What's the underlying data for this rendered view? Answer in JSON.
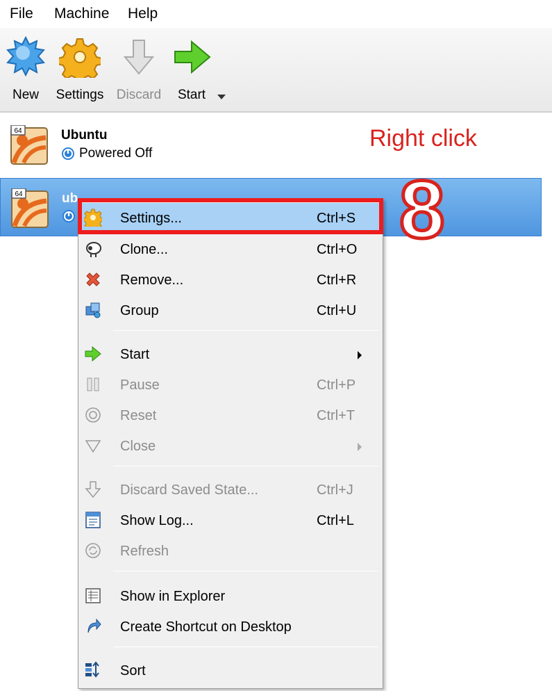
{
  "menubar": {
    "file": "File",
    "machine": "Machine",
    "help": "Help"
  },
  "toolbar": {
    "new": "New",
    "settings": "Settings",
    "discard": "Discard",
    "start": "Start"
  },
  "vms": [
    {
      "name": "Ubuntu",
      "status": "Powered Off",
      "badge": "64"
    },
    {
      "name": "ub",
      "badge": "64"
    }
  ],
  "annotations": {
    "instruction": "Right click",
    "step": "8"
  },
  "context_menu": {
    "settings": {
      "label": "Settings...",
      "shortcut": "Ctrl+S"
    },
    "clone": {
      "label": "Clone...",
      "shortcut": "Ctrl+O"
    },
    "remove": {
      "label": "Remove...",
      "shortcut": "Ctrl+R"
    },
    "group": {
      "label": "Group",
      "shortcut": "Ctrl+U"
    },
    "start": {
      "label": "Start"
    },
    "pause": {
      "label": "Pause",
      "shortcut": "Ctrl+P"
    },
    "reset": {
      "label": "Reset",
      "shortcut": "Ctrl+T"
    },
    "close": {
      "label": "Close"
    },
    "discard_state": {
      "label": "Discard Saved State...",
      "shortcut": "Ctrl+J"
    },
    "show_log": {
      "label": "Show Log...",
      "shortcut": "Ctrl+L"
    },
    "refresh": {
      "label": "Refresh"
    },
    "show_explorer": {
      "label": "Show in Explorer"
    },
    "shortcut_desktop": {
      "label": "Create Shortcut on Desktop"
    },
    "sort": {
      "label": "Sort"
    }
  },
  "colors": {
    "selection": "#5b9ee5",
    "menu_highlight": "#a8d1f5",
    "annotation_red": "#d8231e"
  }
}
